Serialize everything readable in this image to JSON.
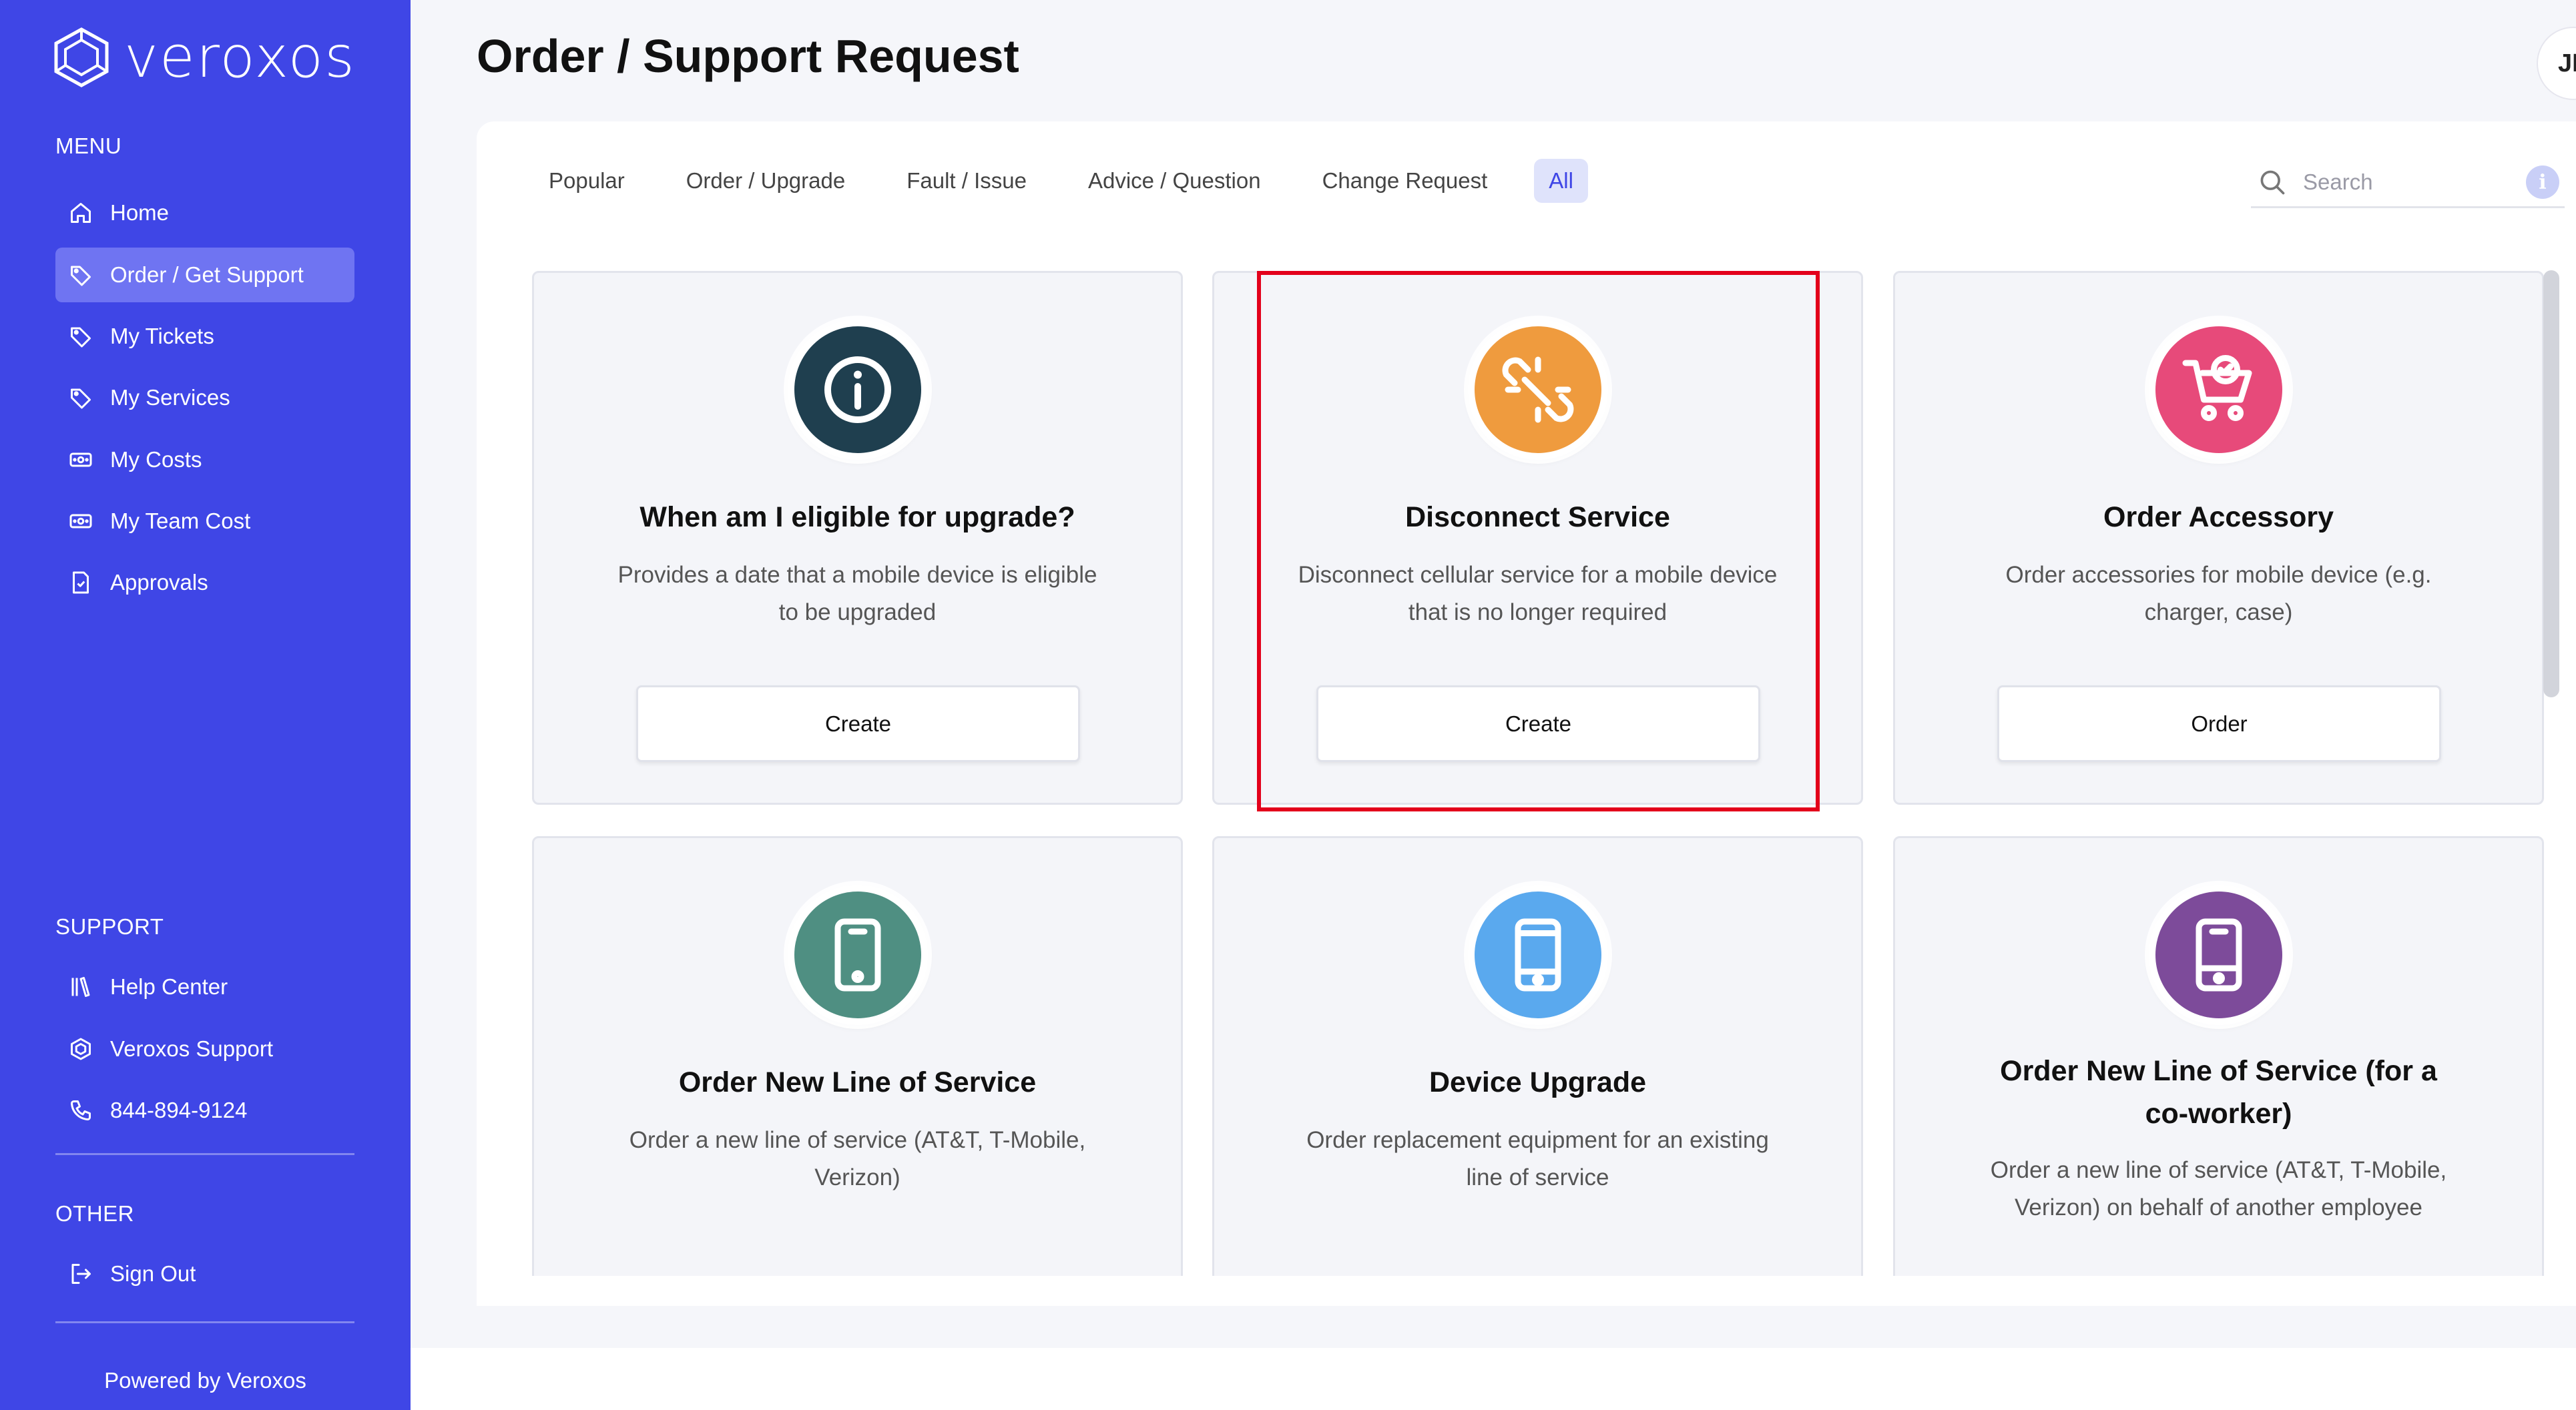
{
  "app": {
    "brand": "veroxos",
    "page_title": "Order / Support Request",
    "avatar_initials": "JI"
  },
  "sidebar": {
    "menu_title": "MENU",
    "menu_items": [
      {
        "label": "Home",
        "icon": "home-icon"
      },
      {
        "label": "Order / Get Support",
        "icon": "tag-icon",
        "active": true
      },
      {
        "label": "My Tickets",
        "icon": "tag-icon"
      },
      {
        "label": "My Services",
        "icon": "tag-icon"
      },
      {
        "label": "My Costs",
        "icon": "money-icon"
      },
      {
        "label": "My Team Cost",
        "icon": "money-icon"
      },
      {
        "label": "Approvals",
        "icon": "document-check-icon"
      }
    ],
    "support_title": "SUPPORT",
    "support_items": [
      {
        "label": "Help Center",
        "icon": "library-icon"
      },
      {
        "label": "Veroxos Support",
        "icon": "hexagon-icon"
      },
      {
        "label": "844-894-9124",
        "icon": "phone-icon"
      }
    ],
    "other_title": "OTHER",
    "other_items": [
      {
        "label": "Sign Out",
        "icon": "sign-out-icon"
      }
    ],
    "footer": "Powered by Veroxos"
  },
  "tabs": [
    {
      "label": "Popular"
    },
    {
      "label": "Order / Upgrade"
    },
    {
      "label": "Fault / Issue"
    },
    {
      "label": "Advice / Question"
    },
    {
      "label": "Change Request"
    },
    {
      "label": "All",
      "active": true
    }
  ],
  "search": {
    "placeholder": "Search"
  },
  "cards": [
    {
      "title": "When am I eligible for upgrade?",
      "description": "Provides a date that a mobile device is eligible to be upgraded",
      "button": "Create",
      "icon": "info-icon",
      "color": "#1f3f4f"
    },
    {
      "title": "Disconnect Service",
      "description": "Disconnect cellular service for a mobile device that is no longer required",
      "button": "Create",
      "icon": "broken-link-icon",
      "color": "#ef9b3e"
    },
    {
      "title": "Order Accessory",
      "description": "Order accessories for mobile device (e.g. charger, case)",
      "button": "Order",
      "icon": "shopping-cart-icon",
      "color": "#e74a7a"
    },
    {
      "title": "Order New Line of Service",
      "description": "Order a new line of service (AT&T, T-Mobile, Verizon)",
      "icon": "mobile-phone-icon",
      "color": "#4f8f82"
    },
    {
      "title": "Device Upgrade",
      "description": "Order replacement equipment for an existing line of service",
      "icon": "mobile-phone-icon",
      "color": "#5aa9ee"
    },
    {
      "title": "Order New Line of Service (for a co-worker)",
      "description": "Order a new line of service (AT&T, T-Mobile, Verizon) on behalf of another employee",
      "icon": "mobile-phone-icon",
      "color": "#7d4b9a"
    }
  ],
  "colors": {
    "sidebar": "#3f46e6",
    "active_nav": "#6f74f2",
    "highlight": "#e3001b",
    "tab_active_bg": "#dfe3fb"
  }
}
